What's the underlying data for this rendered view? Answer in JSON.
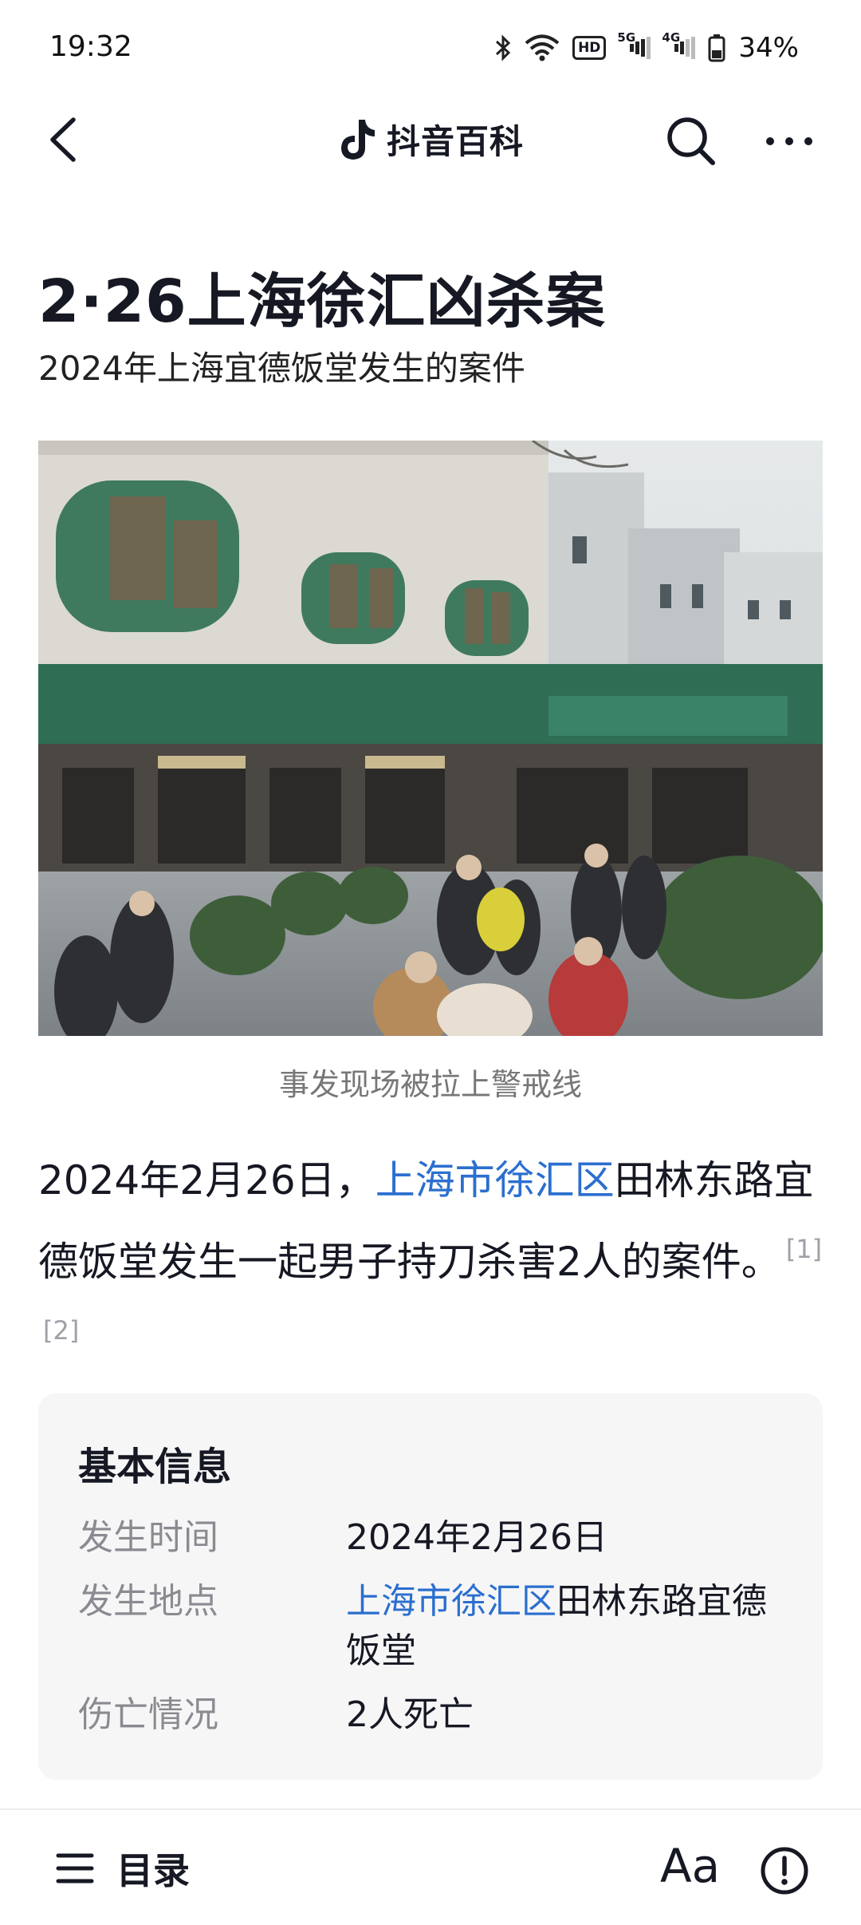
{
  "status_bar": {
    "time": "19:32",
    "battery_percent": "34%",
    "signal_5g": "5G",
    "signal_4g": "4G",
    "hd_badge": "HD",
    "icons": [
      "bluetooth-icon",
      "wifi-icon",
      "hd-voice-icon",
      "signal-5g-icon",
      "signal-4g-icon",
      "battery-icon"
    ]
  },
  "nav": {
    "title": "抖音百科",
    "icons": [
      "back-icon",
      "douyin-logo-icon",
      "search-icon",
      "more-icon"
    ]
  },
  "article": {
    "title": "2·26上海徐汇凶杀案",
    "subtitle": "2024年上海宜德饭堂发生的案件",
    "image_caption": "事发现场被拉上警戒线",
    "paragraph": {
      "part1": "2024年2月26日，",
      "link": "上海市徐汇区",
      "part2": "田林东路宜德饭堂发生一起男子持刀杀害2人的案件。",
      "ref1": "[1]",
      "ref2": "[2]"
    }
  },
  "infobox": {
    "heading": "基本信息",
    "rows": [
      {
        "key": "发生时间",
        "value": "2024年2月26日"
      },
      {
        "key": "发生地点",
        "link": "上海市徐汇区",
        "value": "田林东路宜德饭堂"
      },
      {
        "key": "伤亡情况",
        "value": "2人死亡"
      }
    ]
  },
  "toolbar": {
    "toc_label": "目录",
    "font_label": "Aa",
    "icons": [
      "menu-icon",
      "feedback-icon"
    ]
  },
  "colors": {
    "link": "#2b6fcf",
    "text": "#161823",
    "muted": "#8a8b91",
    "card_bg": "#f6f6f7"
  }
}
